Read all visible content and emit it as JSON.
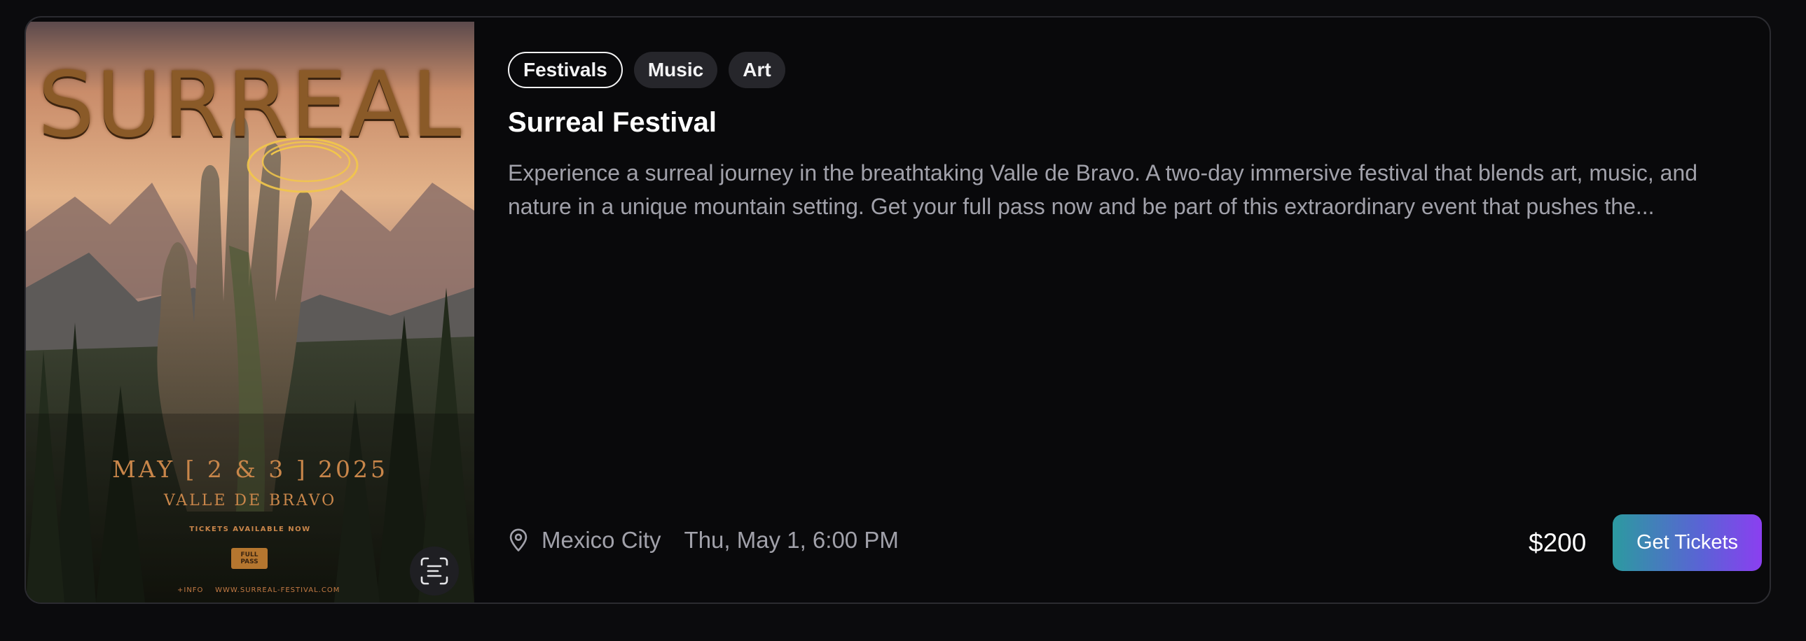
{
  "poster": {
    "title": "SURREAL",
    "date_line": "MAY [ 2 & 3 ] 2025",
    "venue_line": "VALLE DE BRAVO",
    "tickets_line": "TICKETS AVAILABLE NOW",
    "pass_badge": "FULL PASS",
    "info_line": "+INFO    WWW.SURREAL-FESTIVAL.COM",
    "scan_icon": "scan-text-icon"
  },
  "tags": [
    {
      "label": "Festivals",
      "active": true
    },
    {
      "label": "Music",
      "active": false
    },
    {
      "label": "Art",
      "active": false
    }
  ],
  "event": {
    "title": "Surreal Festival",
    "description": "Experience a surreal journey in the breathtaking Valle de Bravo. A two-day immersive festival that blends art, music, and nature in a unique mountain setting. Get your full pass now and be part of this extraordinary event that pushes the...",
    "location": "Mexico City",
    "datetime": "Thu, May 1, 6:00 PM",
    "price": "$200",
    "cta_label": "Get Tickets"
  },
  "colors": {
    "background": "#0b0b0d",
    "card_border": "#2b2b30",
    "tag_bg": "#26262b",
    "muted_text": "#a1a1aa",
    "cta_gradient": [
      "#2c9aa0",
      "#8b3ff0"
    ]
  }
}
